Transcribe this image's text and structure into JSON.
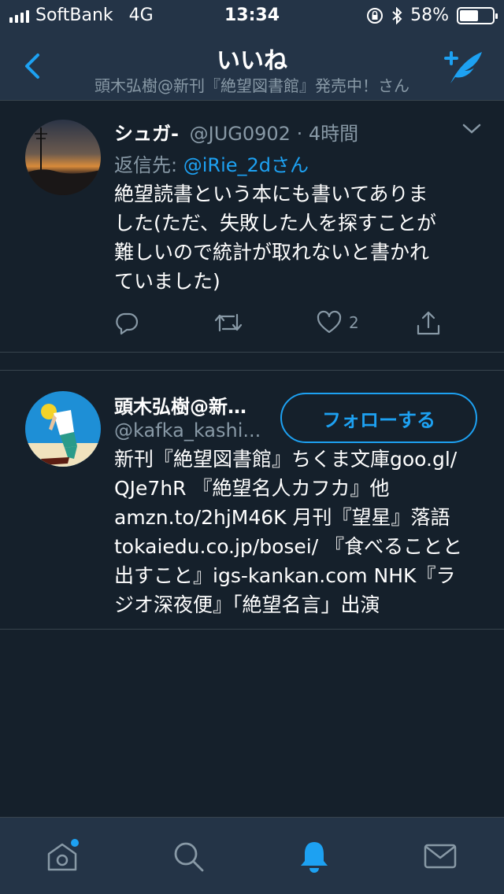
{
  "status_bar": {
    "carrier": "SoftBank",
    "network": "4G",
    "time": "13:34",
    "battery_percent": "58%",
    "battery_level": 0.58
  },
  "header": {
    "title": "いいね",
    "subtitle": "頭木弘樹@新刊『絶望図書館』発売中！さん"
  },
  "tweet": {
    "name": "シュガ-",
    "handle": "@JUG0902",
    "separator": "·",
    "time": "4時間",
    "reply_prefix": "返信先: ",
    "reply_to": "@iRie_2dさん",
    "lines": [
      "絶望読書という本にも書いてありま",
      "した(ただ、失敗した人を探すことが",
      "難しいので統計が取れないと書かれ",
      "ていました)"
    ],
    "like_count": "2"
  },
  "user_card": {
    "name": "頭木弘樹@新…",
    "handle": "@kafka_kashi...",
    "follow_label": "フォローする",
    "bio_lines": [
      "新刊『絶望図書館』ちくま文庫goo.gl/",
      "QJe7hR 『絶望名人カフカ』他",
      "amzn.to/2hjM46K 月刊『望星』落語",
      "tokaiedu.co.jp/bosei/ 『食べることと",
      "出すこと』igs-kankan.com NHK『ラ",
      "ジオ深夜便』「絶望名言」出演"
    ]
  },
  "colors": {
    "background": "#15202b",
    "bar": "#243447",
    "accent": "#1da1f2",
    "muted": "#8899a6"
  },
  "icons": [
    "back-chevron-icon",
    "compose-quill-icon",
    "reply-icon",
    "retweet-icon",
    "heart-icon",
    "share-icon",
    "home-icon",
    "search-icon",
    "notifications-bell-icon",
    "messages-envelope-icon"
  ]
}
